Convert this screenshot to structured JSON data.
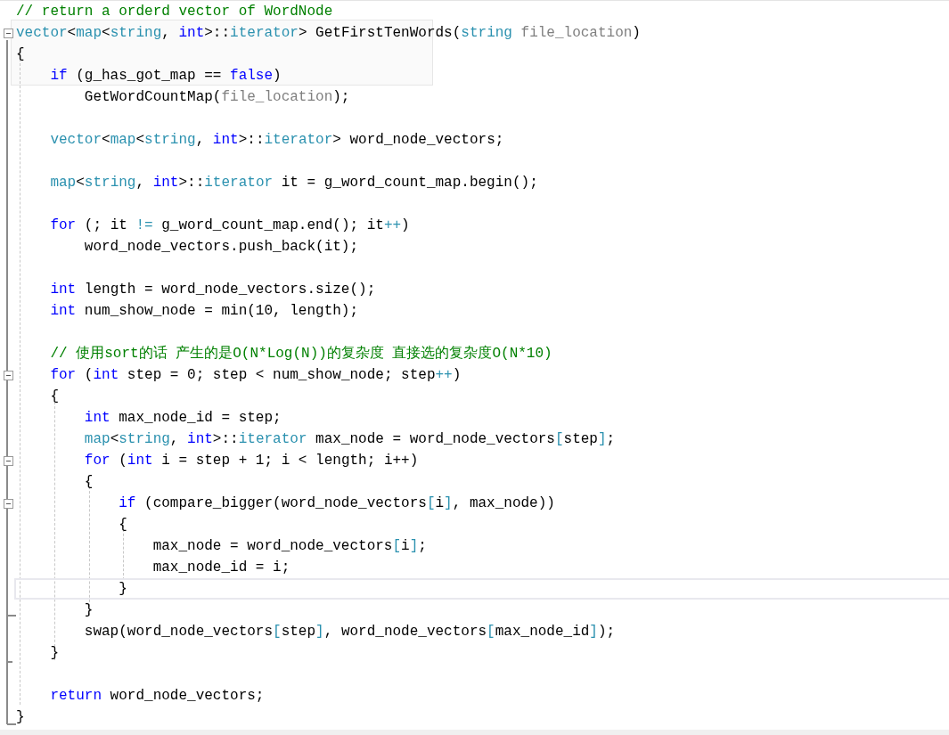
{
  "editor": {
    "lines": [
      {
        "current": false,
        "tokens": [
          {
            "kind": "comment",
            "text": "// return a orderd vector of WordNode"
          }
        ]
      },
      {
        "current": false,
        "expanded": true,
        "tokens": [
          {
            "kind": "type",
            "text": "vector"
          },
          {
            "kind": "plain",
            "text": "<"
          },
          {
            "kind": "type",
            "text": "map"
          },
          {
            "kind": "plain",
            "text": "<"
          },
          {
            "kind": "type",
            "text": "string"
          },
          {
            "kind": "plain",
            "text": ", "
          },
          {
            "kind": "keyword",
            "text": "int"
          },
          {
            "kind": "plain",
            "text": ">::"
          },
          {
            "kind": "type",
            "text": "iterator"
          },
          {
            "kind": "plain",
            "text": "> GetFirstTenWords("
          },
          {
            "kind": "type",
            "text": "string"
          },
          {
            "kind": "param",
            "text": " file_location"
          },
          {
            "kind": "plain",
            "text": ")"
          }
        ]
      },
      {
        "current": false,
        "tokens": [
          {
            "kind": "plain",
            "text": "{"
          }
        ]
      },
      {
        "current": false,
        "tokens": [
          {
            "kind": "keyword",
            "text": "    if"
          },
          {
            "kind": "plain",
            "text": " (g_has_got_map == "
          },
          {
            "kind": "keyword",
            "text": "false"
          },
          {
            "kind": "plain",
            "text": ")"
          }
        ]
      },
      {
        "current": false,
        "tokens": [
          {
            "kind": "plain",
            "text": "        GetWordCountMap("
          },
          {
            "kind": "param",
            "text": "file_location"
          },
          {
            "kind": "plain",
            "text": ");"
          }
        ]
      },
      {
        "current": false
      },
      {
        "current": false,
        "tokens": [
          {
            "kind": "type",
            "text": "    vector"
          },
          {
            "kind": "plain",
            "text": "<"
          },
          {
            "kind": "type",
            "text": "map"
          },
          {
            "kind": "plain",
            "text": "<"
          },
          {
            "kind": "type",
            "text": "string"
          },
          {
            "kind": "plain",
            "text": ", "
          },
          {
            "kind": "keyword",
            "text": "int"
          },
          {
            "kind": "plain",
            "text": ">::"
          },
          {
            "kind": "type",
            "text": "iterator"
          },
          {
            "kind": "plain",
            "text": "> word_node_vectors;"
          }
        ]
      },
      {
        "current": false
      },
      {
        "current": false,
        "tokens": [
          {
            "kind": "type",
            "text": "    map"
          },
          {
            "kind": "plain",
            "text": "<"
          },
          {
            "kind": "type",
            "text": "string"
          },
          {
            "kind": "plain",
            "text": ", "
          },
          {
            "kind": "keyword",
            "text": "int"
          },
          {
            "kind": "plain",
            "text": ">::"
          },
          {
            "kind": "type",
            "text": "iterator"
          },
          {
            "kind": "plain",
            "text": " it = g_word_count_map.begin();"
          }
        ]
      },
      {
        "current": false
      },
      {
        "current": false,
        "tokens": [
          {
            "kind": "keyword",
            "text": "    for"
          },
          {
            "kind": "plain",
            "text": " (; it "
          },
          {
            "kind": "op",
            "text": "!="
          },
          {
            "kind": "plain",
            "text": " g_word_count_map.end(); it"
          },
          {
            "kind": "op",
            "text": "++"
          },
          {
            "kind": "plain",
            "text": ")"
          }
        ]
      },
      {
        "current": false,
        "tokens": [
          {
            "kind": "plain",
            "text": "        word_node_vectors.push_back(it);"
          }
        ]
      },
      {
        "current": false
      },
      {
        "current": false,
        "tokens": [
          {
            "kind": "keyword",
            "text": "    int"
          },
          {
            "kind": "plain",
            "text": " length = word_node_vectors.size();"
          }
        ]
      },
      {
        "current": false,
        "tokens": [
          {
            "kind": "keyword",
            "text": "    int"
          },
          {
            "kind": "plain",
            "text": " num_show_node = min(10, length);"
          }
        ]
      },
      {
        "current": false
      },
      {
        "current": false,
        "tokens": [
          {
            "kind": "comment",
            "text": "    // 使用sort的话 产生的是O(N*Log(N))的复杂度 直接选的复杂度O(N*10)"
          }
        ]
      },
      {
        "current": false,
        "expanded": true,
        "tokens": [
          {
            "kind": "keyword",
            "text": "    for"
          },
          {
            "kind": "plain",
            "text": " ("
          },
          {
            "kind": "keyword",
            "text": "int"
          },
          {
            "kind": "plain",
            "text": " step = 0; step < num_show_node; step"
          },
          {
            "kind": "op",
            "text": "++"
          },
          {
            "kind": "plain",
            "text": ")"
          }
        ]
      },
      {
        "current": false,
        "tokens": [
          {
            "kind": "plain",
            "text": "    {"
          }
        ]
      },
      {
        "current": false,
        "tokens": [
          {
            "kind": "keyword",
            "text": "        int"
          },
          {
            "kind": "plain",
            "text": " max_node_id = step;"
          }
        ]
      },
      {
        "current": false,
        "tokens": [
          {
            "kind": "type",
            "text": "        map"
          },
          {
            "kind": "plain",
            "text": "<"
          },
          {
            "kind": "type",
            "text": "string"
          },
          {
            "kind": "plain",
            "text": ", "
          },
          {
            "kind": "keyword",
            "text": "int"
          },
          {
            "kind": "plain",
            "text": ">::"
          },
          {
            "kind": "type",
            "text": "iterator"
          },
          {
            "kind": "plain",
            "text": " max_node = word_node_vectors"
          },
          {
            "kind": "op",
            "text": "["
          },
          {
            "kind": "plain",
            "text": "step"
          },
          {
            "kind": "op",
            "text": "]"
          },
          {
            "kind": "plain",
            "text": ";"
          }
        ]
      },
      {
        "current": false,
        "expanded": true,
        "tokens": [
          {
            "kind": "keyword",
            "text": "        for"
          },
          {
            "kind": "plain",
            "text": " ("
          },
          {
            "kind": "keyword",
            "text": "int"
          },
          {
            "kind": "plain",
            "text": " i = step + 1; i < length; i++)"
          }
        ]
      },
      {
        "current": false,
        "tokens": [
          {
            "kind": "plain",
            "text": "        {"
          }
        ]
      },
      {
        "current": false,
        "expanded": true,
        "tokens": [
          {
            "kind": "keyword",
            "text": "            if"
          },
          {
            "kind": "plain",
            "text": " (compare_bigger(word_node_vectors"
          },
          {
            "kind": "op",
            "text": "["
          },
          {
            "kind": "plain",
            "text": "i"
          },
          {
            "kind": "op",
            "text": "]"
          },
          {
            "kind": "plain",
            "text": ", max_node))"
          }
        ]
      },
      {
        "current": false,
        "tokens": [
          {
            "kind": "plain",
            "text": "            {"
          }
        ]
      },
      {
        "current": false,
        "tokens": [
          {
            "kind": "plain",
            "text": "                max_node = word_node_vectors"
          },
          {
            "kind": "op",
            "text": "["
          },
          {
            "kind": "plain",
            "text": "i"
          },
          {
            "kind": "op",
            "text": "]"
          },
          {
            "kind": "plain",
            "text": ";"
          }
        ]
      },
      {
        "current": false,
        "tokens": [
          {
            "kind": "plain",
            "text": "                max_node_id = i;"
          }
        ]
      },
      {
        "current": true,
        "tokens": [
          {
            "kind": "plain",
            "text": "            }"
          }
        ]
      },
      {
        "current": false,
        "tokens": [
          {
            "kind": "plain",
            "text": "        }"
          }
        ]
      },
      {
        "current": false,
        "tokens": [
          {
            "kind": "plain",
            "text": "        swap(word_node_vectors"
          },
          {
            "kind": "op",
            "text": "["
          },
          {
            "kind": "plain",
            "text": "step"
          },
          {
            "kind": "op",
            "text": "]"
          },
          {
            "kind": "plain",
            "text": ", word_node_vectors"
          },
          {
            "kind": "op",
            "text": "["
          },
          {
            "kind": "plain",
            "text": "max_node_id"
          },
          {
            "kind": "op",
            "text": "]"
          },
          {
            "kind": "plain",
            "text": ");"
          }
        ]
      },
      {
        "current": false,
        "tokens": [
          {
            "kind": "plain",
            "text": "    }"
          }
        ]
      },
      {
        "current": false
      },
      {
        "current": false,
        "tokens": [
          {
            "kind": "keyword",
            "text": "    return"
          },
          {
            "kind": "plain",
            "text": " word_node_vectors;"
          }
        ]
      },
      {
        "current": false,
        "tokens": [
          {
            "kind": "plain",
            "text": "}"
          }
        ]
      }
    ]
  }
}
